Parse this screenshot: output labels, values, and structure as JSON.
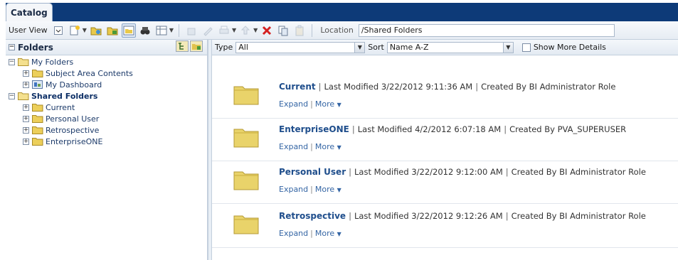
{
  "window": {
    "tab_title": "Catalog"
  },
  "toolbar": {
    "user_view_label": "User View",
    "location_label": "Location",
    "location_value": "/Shared Folders"
  },
  "folders_pane": {
    "title": "Folders",
    "tree": [
      {
        "label": "My Folders",
        "expanded": true,
        "bold": false
      },
      {
        "label": "Subject Area Contents",
        "expanded": false
      },
      {
        "label": "My Dashboard",
        "expanded": false
      },
      {
        "label": "Shared Folders",
        "expanded": true,
        "bold": true
      },
      {
        "label": "Current",
        "expanded": false
      },
      {
        "label": "Personal User",
        "expanded": false
      },
      {
        "label": "Retrospective",
        "expanded": false
      },
      {
        "label": "EnterpriseONE",
        "expanded": false
      }
    ]
  },
  "filter_bar": {
    "type_label": "Type",
    "type_value": "All",
    "sort_label": "Sort",
    "sort_value": "Name A-Z",
    "show_more_label": "Show More Details"
  },
  "items": [
    {
      "name": "Current",
      "modified": "Last Modified 3/22/2012 9:11:36 AM",
      "created": "Created By BI Administrator Role",
      "expand": "Expand",
      "more": "More"
    },
    {
      "name": "EnterpriseONE",
      "modified": "Last Modified 4/2/2012 6:07:18 AM",
      "created": "Created By PVA_SUPERUSER",
      "expand": "Expand",
      "more": "More"
    },
    {
      "name": "Personal User",
      "modified": "Last Modified 3/22/2012 9:12:00 AM",
      "created": "Created By BI Administrator Role",
      "expand": "Expand",
      "more": "More"
    },
    {
      "name": "Retrospective",
      "modified": "Last Modified 3/22/2012 9:12:26 AM",
      "created": "Created By BI Administrator Role",
      "expand": "Expand",
      "more": "More"
    }
  ],
  "colors": {
    "header_blue": "#0d3a78",
    "link_blue": "#1f4e8c",
    "folder_yellow": "#e9d36a"
  }
}
